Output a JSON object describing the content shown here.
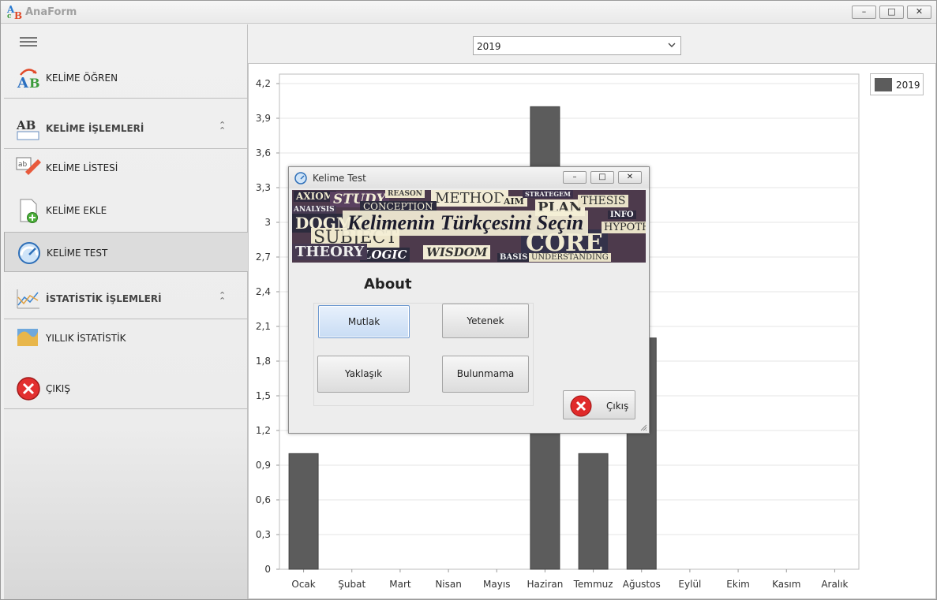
{
  "app": {
    "title": "AnaForm"
  },
  "window_controls": {
    "minimize": "–",
    "maximize": "□",
    "close": "✕"
  },
  "sidebar": {
    "menu_icon": "hamburger-icon",
    "items": [
      {
        "label": "KELİME ÖĞREN",
        "icon": "ab-learn-icon"
      },
      {
        "label": "KELİME İŞLEMLERİ",
        "icon": "ab-book-icon",
        "group": true
      },
      {
        "label": "KELİME LİSTESİ",
        "icon": "list-edit-icon"
      },
      {
        "label": "KELİME EKLE",
        "icon": "document-add-icon"
      },
      {
        "label": "KELİME TEST",
        "icon": "gauge-icon",
        "selected": true
      },
      {
        "label": "İSTATİSTİK İŞLEMLERİ",
        "icon": "line-chart-icon",
        "group": true
      },
      {
        "label": "YILLIK İSTATİSTİK",
        "icon": "area-chart-icon"
      },
      {
        "label": "ÇIKIŞ",
        "icon": "close-circle-icon"
      }
    ],
    "collapse_glyph": "⌃"
  },
  "main": {
    "year_select": {
      "value": "2019"
    }
  },
  "chart_data": {
    "type": "bar",
    "categories": [
      "Ocak",
      "Şubat",
      "Mart",
      "Nisan",
      "Mayıs",
      "Haziran",
      "Temmuz",
      "Ağustos",
      "Eylül",
      "Ekim",
      "Kasım",
      "Aralık"
    ],
    "series": [
      {
        "name": "2019",
        "values": [
          1,
          0,
          0,
          0,
          0,
          4,
          1,
          2,
          0,
          0,
          0,
          0
        ],
        "color": "#5c5c5c"
      }
    ],
    "ylim": [
      0,
      4.2
    ],
    "yticks": [
      "0",
      "0,3",
      "0,6",
      "0,9",
      "1,2",
      "1,5",
      "1,8",
      "2,1",
      "2,4",
      "2,7",
      "3",
      "3,3",
      "3,6",
      "3,9",
      "4,2"
    ],
    "legend": "top-right",
    "grid": true
  },
  "dialog": {
    "title": "Kelime Test",
    "banner_heading": "Kelimenin Türkçesini Seçin",
    "banner_words": [
      "AXIOM",
      "STUDY",
      "REASON",
      "METHOD",
      "CONCEPTION",
      "AIM",
      "STRATEGEM",
      "PLAN",
      "THESIS",
      "ANALYSIS",
      "DOGMA",
      "SUBJECT",
      "CORE",
      "LOGIC",
      "WISDOM",
      "INFO",
      "HYPOTHESIS",
      "THEORY",
      "BASIS",
      "UNDERSTANDING"
    ],
    "section_label": "About",
    "options": [
      "Mutlak",
      "Yetenek",
      "Yaklaşık",
      "Bulunmama"
    ],
    "exit_label": "Çıkış"
  }
}
